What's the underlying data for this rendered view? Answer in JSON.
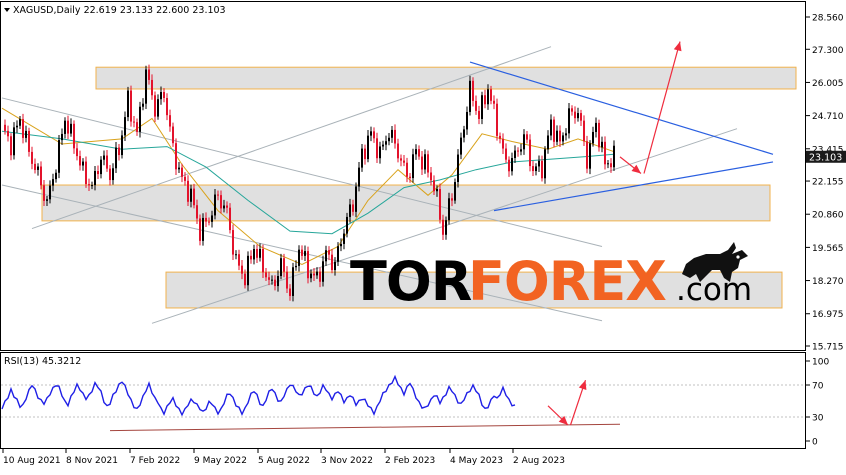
{
  "header": {
    "symbol_line": "XAGUSD,Daily  22.619 23.133 22.600 23.103"
  },
  "rsi_header": "RSI(13) 45.3212",
  "watermark": {
    "tor": "TOR",
    "forex": "FOREX",
    "com": ".com",
    "bull_icon": "bull-logo-icon"
  },
  "colors": {
    "up_candle": "#000000",
    "down_candle": "#e3122b",
    "ma_fast": "#d9a21b",
    "ma_slow": "#26a69a",
    "rsi_line": "#1f1fe6",
    "channel": "#a9b2b8",
    "triangle": "#2a5fe0",
    "arrow": "#ef2c3e",
    "zone_fill": "#dadada",
    "zone_border": "#f2b24c",
    "rsi_trend": "#a4453e",
    "price_label_bg": "#1a1a1a",
    "watermark_orange": "#f26322"
  },
  "chart_data": [
    {
      "type": "candlestick",
      "series_name": "XAGUSD",
      "timeframe": "Daily",
      "last_bar": {
        "open": 22.619,
        "high": 23.133,
        "low": 22.6,
        "close": 23.103
      },
      "current_price_label": "23.103",
      "y_ticks": [
        "28.560",
        "27.300",
        "26.005",
        "24.710",
        "23.415",
        "22.155",
        "20.860",
        "19.565",
        "18.270",
        "16.975",
        "15.715"
      ],
      "y_tick_values": [
        28.56,
        27.3,
        26.005,
        24.71,
        23.415,
        22.155,
        20.86,
        19.565,
        18.27,
        16.975,
        15.715
      ],
      "ylim": [
        15.715,
        28.56
      ],
      "x_ticks": [
        "10 Aug 2021",
        "8 Nov 2021",
        "7 Feb 2022",
        "9 May 2022",
        "5 Aug 2022",
        "3 Nov 2022",
        "2 Feb 2023",
        "4 May 2023",
        "2 Aug 2023"
      ],
      "price_path": [
        [
          0,
          24.2
        ],
        [
          3,
          23.6
        ],
        [
          6,
          24.6
        ],
        [
          9,
          23.3
        ],
        [
          12,
          22.4
        ],
        [
          15,
          21.3
        ],
        [
          18,
          22.8
        ],
        [
          21,
          24.6
        ],
        [
          24,
          23.6
        ],
        [
          27,
          22.5
        ],
        [
          30,
          21.9
        ],
        [
          33,
          23.1
        ],
        [
          36,
          22.4
        ],
        [
          39,
          23.4
        ],
        [
          42,
          25.3
        ],
        [
          45,
          24.0
        ],
        [
          48,
          26.4
        ],
        [
          51,
          25.0
        ],
        [
          54,
          25.6
        ],
        [
          57,
          23.4
        ],
        [
          60,
          22.2
        ],
        [
          63,
          21.6
        ],
        [
          66,
          20.2
        ],
        [
          69,
          20.7
        ],
        [
          72,
          21.6
        ],
        [
          75,
          20.9
        ],
        [
          78,
          19.0
        ],
        [
          81,
          18.4
        ],
        [
          84,
          19.6
        ],
        [
          87,
          18.8
        ],
        [
          90,
          18.0
        ],
        [
          93,
          18.9
        ],
        [
          96,
          17.8
        ],
        [
          99,
          19.6
        ],
        [
          102,
          18.7
        ],
        [
          105,
          18.3
        ],
        [
          108,
          19.3
        ],
        [
          111,
          18.9
        ],
        [
          114,
          20.3
        ],
        [
          117,
          21.3
        ],
        [
          120,
          23.2
        ],
        [
          123,
          24.0
        ],
        [
          126,
          23.2
        ],
        [
          129,
          24.1
        ],
        [
          132,
          23.3
        ],
        [
          135,
          22.3
        ],
        [
          138,
          23.3
        ],
        [
          141,
          22.8
        ],
        [
          144,
          22.0
        ],
        [
          147,
          20.2
        ],
        [
          150,
          21.6
        ],
        [
          153,
          23.7
        ],
        [
          156,
          25.7
        ],
        [
          159,
          24.7
        ],
        [
          162,
          25.8
        ],
        [
          165,
          24.3
        ],
        [
          168,
          22.8
        ],
        [
          171,
          23.1
        ],
        [
          174,
          23.9
        ],
        [
          177,
          22.6
        ],
        [
          180,
          22.7
        ],
        [
          183,
          24.4
        ],
        [
          186,
          23.6
        ],
        [
          189,
          24.7
        ],
        [
          192,
          24.9
        ],
        [
          195,
          23.0
        ],
        [
          198,
          24.4
        ],
        [
          201,
          22.8
        ],
        [
          204,
          23.1
        ]
      ],
      "moving_averages": [
        {
          "name": "MA fast",
          "color_key": "ma_fast",
          "points": [
            [
              0,
              25.0
            ],
            [
              20,
              23.6
            ],
            [
              40,
              23.8
            ],
            [
              50,
              24.6
            ],
            [
              60,
              22.8
            ],
            [
              72,
              21.0
            ],
            [
              86,
              19.6
            ],
            [
              100,
              18.9
            ],
            [
              112,
              19.6
            ],
            [
              122,
              21.4
            ],
            [
              132,
              22.6
            ],
            [
              142,
              21.6
            ],
            [
              150,
              22.4
            ],
            [
              160,
              24.0
            ],
            [
              170,
              23.7
            ],
            [
              182,
              23.4
            ],
            [
              192,
              23.8
            ],
            [
              204,
              23.3
            ]
          ]
        },
        {
          "name": "MA slow",
          "color_key": "ma_slow",
          "points": [
            [
              0,
              24.1
            ],
            [
              20,
              23.8
            ],
            [
              40,
              23.4
            ],
            [
              55,
              23.5
            ],
            [
              68,
              22.7
            ],
            [
              82,
              21.4
            ],
            [
              96,
              20.2
            ],
            [
              110,
              20.1
            ],
            [
              122,
              20.9
            ],
            [
              134,
              21.9
            ],
            [
              146,
              22.2
            ],
            [
              158,
              22.6
            ],
            [
              170,
              22.9
            ],
            [
              182,
              23.0
            ],
            [
              194,
              23.1
            ],
            [
              204,
              23.2
            ]
          ]
        }
      ],
      "support_resistance_zones": [
        {
          "upper": 26.6,
          "lower": 25.75
        },
        {
          "upper": 22.0,
          "lower": 20.6
        },
        {
          "upper": 18.6,
          "lower": 17.2
        }
      ],
      "channel_lines": [
        [
          [
            0,
            25.4
          ],
          [
            200,
            19.6
          ]
        ],
        [
          [
            0,
            22.0
          ],
          [
            200,
            16.7
          ]
        ],
        [
          [
            10,
            20.3
          ],
          [
            183,
            27.4
          ]
        ],
        [
          [
            50,
            16.6
          ],
          [
            245,
            24.2
          ]
        ]
      ],
      "triangle_lines": [
        [
          [
            156,
            26.8
          ],
          [
            257,
            23.2
          ]
        ],
        [
          [
            164,
            21.0
          ],
          [
            257,
            22.9
          ]
        ]
      ],
      "forecast_arrows": [
        [
          [
            206,
            23.1
          ],
          [
            213,
            22.45
          ]
        ],
        [
          [
            214,
            22.45
          ],
          [
            226,
            27.6
          ]
        ]
      ]
    },
    {
      "type": "line",
      "series_name": "RSI(13)",
      "current_value": 45.3212,
      "y_ticks": [
        "100",
        "70",
        "30",
        "0"
      ],
      "y_tick_values": [
        100,
        70,
        30,
        0
      ],
      "ylim": [
        0,
        100
      ],
      "values": [
        40,
        48,
        56,
        64,
        56,
        50,
        44,
        46,
        54,
        62,
        70,
        64,
        56,
        50,
        46,
        52,
        60,
        66,
        70,
        66,
        58,
        50,
        46,
        54,
        62,
        70,
        66,
        58,
        52,
        56,
        64,
        72,
        68,
        60,
        50,
        44,
        48,
        56,
        62,
        70,
        76,
        68,
        58,
        50,
        44,
        40,
        46,
        54,
        64,
        72,
        62,
        52,
        48,
        40,
        36,
        42,
        48,
        52,
        46,
        40,
        34,
        38,
        46,
        52,
        50,
        44,
        40,
        36,
        42,
        48,
        46,
        40,
        36,
        40,
        48,
        56,
        60,
        54,
        46,
        40,
        34,
        40,
        50,
        58,
        62,
        56,
        48,
        44,
        52,
        60,
        66,
        60,
        52,
        48,
        56,
        64,
        72,
        68,
        62,
        56,
        60,
        66,
        70,
        66,
        60,
        56,
        62,
        68,
        64,
        58,
        54,
        58,
        62,
        56,
        50,
        54,
        58,
        52,
        46,
        50,
        54,
        50,
        44,
        40,
        36,
        42,
        50,
        58,
        64,
        70,
        74,
        78,
        72,
        66,
        60,
        66,
        72,
        64,
        56,
        48,
        42,
        40,
        46,
        52,
        58,
        54,
        48,
        54,
        60,
        66,
        62,
        56,
        50,
        46,
        52,
        58,
        64,
        70,
        64,
        56,
        46,
        40,
        44,
        50,
        56,
        52,
        60,
        66,
        58,
        50,
        46,
        45
      ],
      "trend_line": [
        [
          0,
          13
        ],
        [
          207,
          21
        ]
      ],
      "forecast_arrows": [
        [
          [
            172,
            44
          ],
          [
            180,
            20
          ]
        ],
        [
          [
            181,
            20
          ],
          [
            187,
            76
          ]
        ]
      ]
    }
  ]
}
